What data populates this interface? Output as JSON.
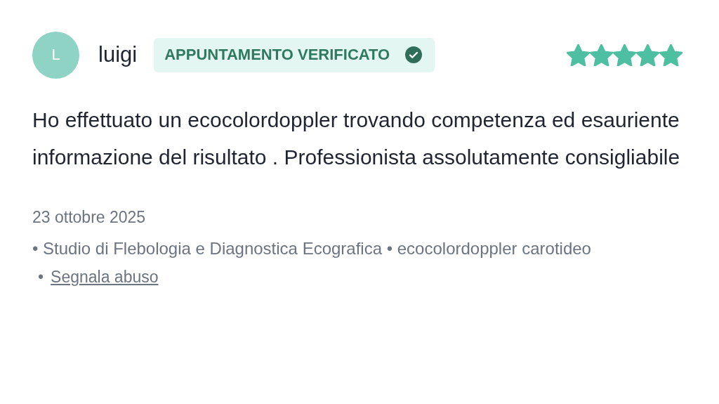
{
  "review": {
    "avatar_initial": "L",
    "author": "luigi",
    "badge": {
      "label": "APPUNTAMENTO VERIFICATO",
      "verified": true
    },
    "stars": 5,
    "text": "Ho effettuato un ecocolordoppler trovando competenza ed esauriente informazione del risultato . Professionista assolutamente consigliabile",
    "date": "23 ottobre 2025",
    "details": "• Studio di Flebologia e Diagnostica Ecografica • ecocolordoppler carotideo",
    "report_bullet": "•",
    "report_link": "Segnala abuso"
  }
}
